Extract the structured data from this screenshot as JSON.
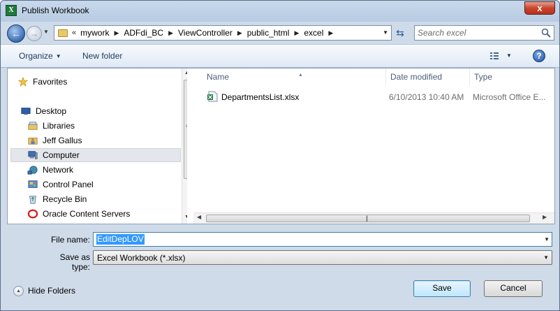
{
  "window": {
    "title": "Publish Workbook",
    "app_icon_letter": "X",
    "close_glyph": "x"
  },
  "navigation": {
    "back_glyph": "←",
    "forward_glyph": "→",
    "address_overflow": "«",
    "breadcrumbs": [
      "mywork",
      "ADFdi_BC",
      "ViewController",
      "public_html",
      "excel"
    ],
    "search_placeholder": "Search excel"
  },
  "toolbar": {
    "organize_label": "Organize",
    "new_folder_label": "New folder",
    "help_label": "?"
  },
  "nav_pane": {
    "items": [
      {
        "label": "Favorites",
        "icon": "star-icon"
      },
      {
        "label": "Desktop",
        "icon": "desktop-icon"
      },
      {
        "label": "Libraries",
        "icon": "libraries-icon"
      },
      {
        "label": "Jeff Gallus",
        "icon": "user-folder-icon"
      },
      {
        "label": "Computer",
        "icon": "computer-icon",
        "selected": true
      },
      {
        "label": "Network",
        "icon": "network-icon"
      },
      {
        "label": "Control Panel",
        "icon": "control-panel-icon"
      },
      {
        "label": "Recycle Bin",
        "icon": "recycle-bin-icon"
      },
      {
        "label": "Oracle Content Servers",
        "icon": "oracle-icon"
      }
    ]
  },
  "file_list": {
    "columns": {
      "name": "Name",
      "date": "Date modified",
      "type": "Type"
    },
    "rows": [
      {
        "name": "DepartmentsList.xlsx",
        "date": "6/10/2013 10:40 AM",
        "type": "Microsoft Office E..."
      }
    ]
  },
  "form": {
    "file_name_label": "File name:",
    "file_name_value": "EditDepLOV",
    "save_as_type_label": "Save as type:",
    "save_as_type_value": "Excel Workbook (*.xlsx)"
  },
  "footer": {
    "hide_folders_label": "Hide Folders",
    "save_label": "Save",
    "cancel_label": "Cancel"
  },
  "colors": {
    "title_bar": "#c9d9ec",
    "close_button": "#c8452e",
    "selection": "#3399ff",
    "excel_green": "#1f7a3c"
  }
}
